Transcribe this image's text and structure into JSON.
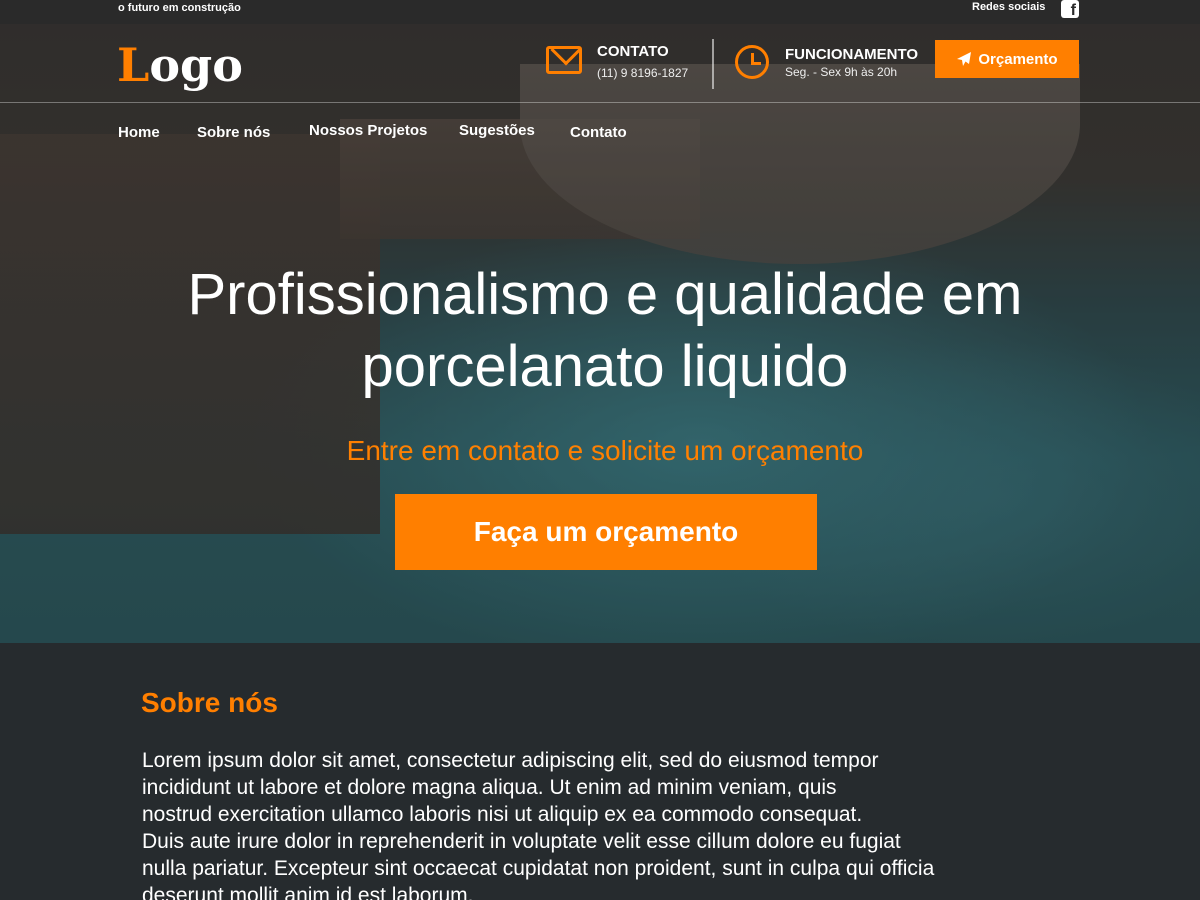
{
  "topbar": {
    "tagline": "o futuro em construção",
    "social_label": "Redes sociais",
    "social_icon": "facebook-icon"
  },
  "header": {
    "logo_first": "L",
    "logo_rest": "ogo",
    "contact": {
      "icon": "envelope-icon",
      "title": "CONTATO",
      "phone": "(11) 9 8196-1827"
    },
    "hours": {
      "icon": "clock-icon",
      "title": "FUNCIONAMENTO",
      "text": "Seg. - Sex 9h às 20h"
    },
    "quote_button": {
      "icon": "paper-plane-icon",
      "label": "Orçamento"
    }
  },
  "nav": {
    "items": [
      {
        "label": "Home"
      },
      {
        "label": "Sobre nós"
      },
      {
        "label": "Nossos Projetos"
      },
      {
        "label": "Sugestões"
      },
      {
        "label": "Contato"
      }
    ]
  },
  "hero": {
    "title_line1": "Profissionalismo e qualidade em",
    "title_line2": "porcelanato liquido",
    "subtitle": "Entre em contato e solicite um orçamento",
    "cta_label": "Faça um orçamento"
  },
  "about": {
    "heading": "Sobre nós",
    "lines": [
      "Lorem ipsum dolor sit amet, consectetur adipiscing elit, sed do eiusmod tempor",
      "incididunt ut labore et dolore magna aliqua. Ut enim ad minim veniam, quis",
      "nostrud exercitation ullamco laboris nisi ut aliquip ex ea commodo consequat.",
      "Duis aute irure dolor in reprehenderit in voluptate velit esse cillum dolore eu fugiat",
      "nulla pariatur. Excepteur sint occaecat cupidatat non proident, sunt in culpa qui officia",
      "deserunt mollit anim id est laborum."
    ]
  },
  "colors": {
    "accent": "#ff7f00",
    "dark": "#262b2e",
    "topbar": "#2a2a2a"
  }
}
